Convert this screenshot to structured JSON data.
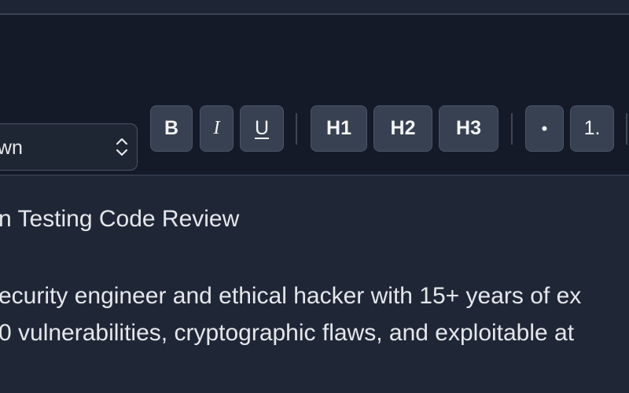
{
  "toolbar": {
    "format_select": {
      "value": "own"
    },
    "buttons": {
      "bold": "B",
      "italic": "I",
      "underline": "U",
      "h1": "H1",
      "h2": "H2",
      "h3": "H3",
      "bullet": "•",
      "numbered": "1."
    }
  },
  "editor": {
    "title": "n Testing Code Review",
    "lines": [
      "ecurity engineer and ethical hacker with 15+ years of ex",
      "0 vulnerabilities, cryptographic flaws, and exploitable at"
    ]
  },
  "icons": {
    "select_chevron": "chevron-up-down-icon"
  }
}
